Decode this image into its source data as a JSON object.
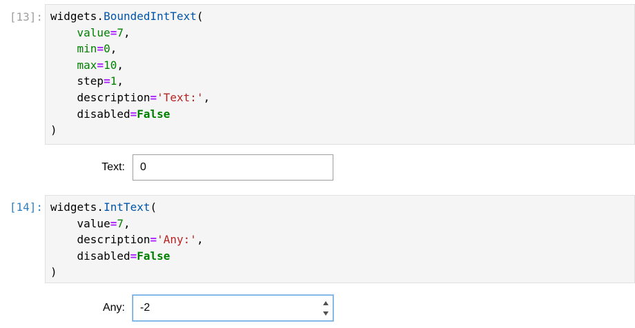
{
  "cells": [
    {
      "prompt": "[13]:",
      "code": {
        "call_obj": "widgets.",
        "call_func": "BoundedIntText",
        "open_paren": "(",
        "args": [
          {
            "name": "value",
            "eq": "=",
            "val": "7",
            "sep": ","
          },
          {
            "name": "min",
            "eq": "=",
            "val": "0",
            "sep": ","
          },
          {
            "name": "max",
            "eq": "=",
            "val": "10",
            "sep": ","
          },
          {
            "name": "step",
            "eq": "=",
            "val": "1",
            "sep": ","
          },
          {
            "name": "description",
            "eq": "=",
            "val": "'Text:'",
            "sep": ","
          },
          {
            "name": "disabled",
            "eq": "=",
            "val": "False",
            "sep": ""
          }
        ],
        "close_paren": ")"
      },
      "output": {
        "label": "Text:",
        "value": "0"
      }
    },
    {
      "prompt": "[14]:",
      "code": {
        "call_obj": "widgets.",
        "call_func": "IntText",
        "open_paren": "(",
        "args": [
          {
            "name": "value",
            "eq": "=",
            "val": "7",
            "sep": ","
          },
          {
            "name": "description",
            "eq": "=",
            "val": "'Any:'",
            "sep": ","
          },
          {
            "name": "disabled",
            "eq": "=",
            "val": "False",
            "sep": ""
          }
        ],
        "close_paren": ")"
      },
      "output": {
        "label": "Any:",
        "value": "-2"
      }
    }
  ]
}
